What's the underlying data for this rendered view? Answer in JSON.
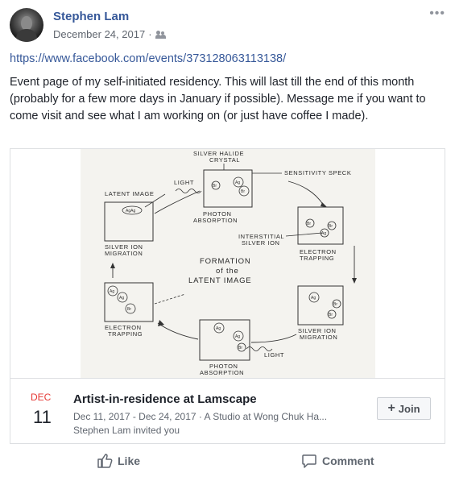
{
  "post": {
    "author": "Stephen Lam",
    "date": "December 24, 2017",
    "separator": "·",
    "audience_icon": "friends-icon",
    "more_label": "•••",
    "link": "https://www.facebook.com/events/373128063113138/",
    "body": "Event page of my self-initiated residency. This will last till the end of this month (probably for a few more days in January if possible). Message me if you want to come visit and see what I am working on (or just have coffee I made)."
  },
  "diagram": {
    "top_label_1": "SILVER HALIDE",
    "top_label_2": "CRYSTAL",
    "sensitivity": "SENSITIVITY SPECK",
    "light_top": "LIGHT",
    "latent_image": "LATENT IMAGE",
    "photon_abs_top_1": "PHOTON",
    "photon_abs_top_2": "ABSORPTION",
    "interstitial_1": "INTERSTITIAL",
    "interstitial_2": "SILVER ION",
    "electron_trap_right_1": "ELECTRON",
    "electron_trap_right_2": "TRAPPING",
    "silver_migr_left_1": "SILVER ION",
    "silver_migr_left_2": "MIGRATION",
    "center_1": "FORMATION",
    "center_2": "of the",
    "center_3": "LATENT IMAGE",
    "electron_trap_left_1": "ELECTRON",
    "electron_trap_left_2": "TRAPPING",
    "silver_migr_right_1": "SILVER ION",
    "silver_migr_right_2": "MIGRATION",
    "light_bottom": "LIGHT",
    "photon_abs_bottom_1": "PHOTON",
    "photon_abs_bottom_2": "ABSORPTION",
    "ag": "Ag",
    "br": "Br",
    "agag": "AgAg"
  },
  "event": {
    "month": "DEC",
    "day": "11",
    "title": "Artist-in-residence at Lamscape",
    "subtitle": "Dec 11, 2017 - Dec 24, 2017 · A Studio at Wong Chuk Ha...",
    "invite": "Stephen Lam invited you",
    "join_icon": "+",
    "join_label": "Join"
  },
  "actions": {
    "like": "Like",
    "comment": "Comment"
  },
  "colors": {
    "link": "#365899",
    "month": "#e53935",
    "text": "#1d2129",
    "meta": "#616770"
  }
}
